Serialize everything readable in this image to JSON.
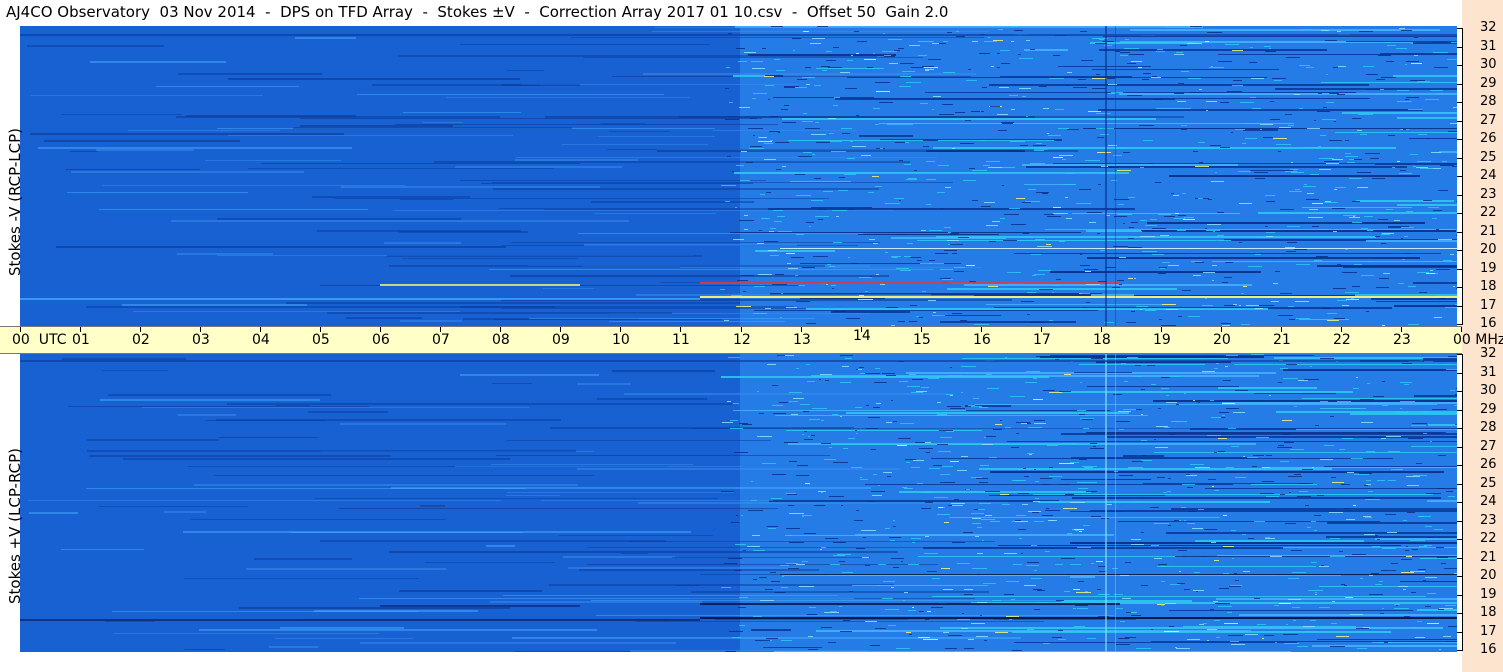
{
  "title": "AJ4CO Observatory  03 Nov 2014  -  DPS on TFD Array  -  Stokes ±V  -  Correction Array 2017 01 10.csv  -  Offset 50  Gain 2.0",
  "panels": [
    {
      "label": "Stokes -V (RCP-LCP)"
    },
    {
      "label": "Stokes +V (LCP-RCP)"
    }
  ],
  "time_axis": {
    "labels": [
      "00",
      "01",
      "02",
      "03",
      "04",
      "05",
      "06",
      "07",
      "08",
      "09",
      "10",
      "11",
      "12",
      "13",
      "14",
      "15",
      "16",
      "17",
      "18",
      "19",
      "20",
      "21",
      "22",
      "23",
      "00"
    ],
    "left_unit": "UTC",
    "right_unit": "MHz"
  },
  "freq_axis": {
    "labels": [
      "32",
      "31",
      "30",
      "29",
      "28",
      "27",
      "26",
      "25",
      "24",
      "23",
      "22",
      "21",
      "20",
      "19",
      "18",
      "17",
      "16"
    ]
  },
  "colors": {
    "background_blue": "#1e6fe0",
    "dark_blue": "#0a3fa8",
    "cyan": "#2ec8f0",
    "yellow": "#f5f57a",
    "red": "#e03c3c",
    "timebar": "#ffffc8",
    "right_strip": "#fde4cf"
  },
  "chart_data": {
    "type": "heatmap",
    "title": "AJ4CO Observatory  03 Nov 2014  -  DPS on TFD Array  -  Stokes ±V  -  Correction Array 2017 01 10.csv  -  Offset 50  Gain 2.0",
    "xlabel": "UTC",
    "ylabel_units": "MHz",
    "x_range": [
      "00",
      "00"
    ],
    "y_range": [
      16,
      32
    ],
    "series": [
      {
        "name": "Stokes -V (RCP-LCP)"
      },
      {
        "name": "Stokes +V (LCP-RCP)"
      }
    ]
  }
}
